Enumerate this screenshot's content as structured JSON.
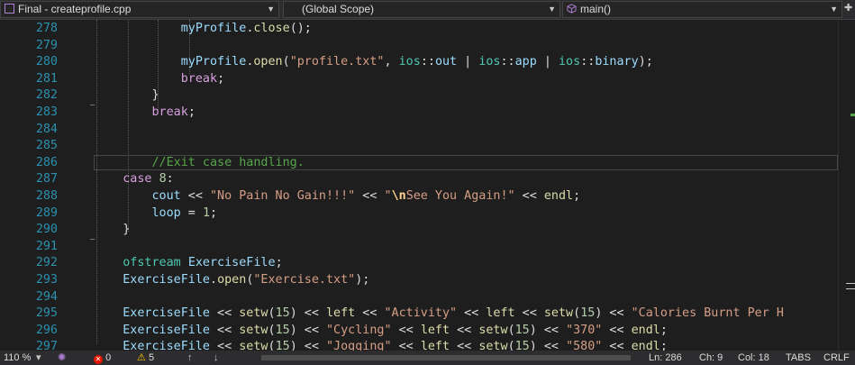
{
  "nav": {
    "file_dropdown": "Final - createprofile.cpp",
    "scope_dropdown": "(Global Scope)",
    "member_dropdown": "main()"
  },
  "code": {
    "lines": [
      {
        "n": "278",
        "html": "            <span class='vr'>myProfile</span>.<span class='fn'>close</span>();"
      },
      {
        "n": "279",
        "html": ""
      },
      {
        "n": "280",
        "html": "            <span class='vr'>myProfile</span>.<span class='fn'>open</span>(<span class='st'>\"profile.txt\"</span>, <span class='ty'>ios</span>::<span class='vr'>out</span> | <span class='ty'>ios</span>::<span class='vr'>app</span> | <span class='ty'>ios</span>::<span class='vr'>binary</span>);"
      },
      {
        "n": "281",
        "html": "            <span class='kw'>break</span>;"
      },
      {
        "n": "282",
        "html": "        }"
      },
      {
        "n": "283",
        "html": "        <span class='kw'>break</span>;"
      },
      {
        "n": "284",
        "html": ""
      },
      {
        "n": "285",
        "html": ""
      },
      {
        "n": "286",
        "html": "        <span class='cm'>//Exit case handling.</span>"
      },
      {
        "n": "287",
        "html": "    <span class='kw'>case</span> <span class='nm'>8</span>:"
      },
      {
        "n": "288",
        "html": "        <span class='vr'>cout</span> &lt;&lt; <span class='st'>\"No Pain No Gain!!!\"</span> &lt;&lt; <span class='st'>\"</span><span class='esc'>\\n</span><span class='st'>See You Again!\"</span> &lt;&lt; <span class='fn'>endl</span>;"
      },
      {
        "n": "289",
        "html": "        <span class='vr'>loop</span> = <span class='nm'>1</span>;"
      },
      {
        "n": "290",
        "html": "    }"
      },
      {
        "n": "291",
        "html": ""
      },
      {
        "n": "292",
        "html": "    <span class='ty'>ofstream</span> <span class='vr'>ExerciseFile</span>;"
      },
      {
        "n": "293",
        "html": "    <span class='vr'>ExerciseFile</span>.<span class='fn'>open</span>(<span class='st'>\"Exercise.txt\"</span>);"
      },
      {
        "n": "294",
        "html": ""
      },
      {
        "n": "295",
        "html": "    <span class='vr'>ExerciseFile</span> &lt;&lt; <span class='fn'>setw</span>(<span class='nm'>15</span>) &lt;&lt; <span class='fn'>left</span> &lt;&lt; <span class='st'>\"Activity\"</span> &lt;&lt; <span class='fn'>left</span> &lt;&lt; <span class='fn'>setw</span>(<span class='nm'>15</span>) &lt;&lt; <span class='st'>\"Calories Burnt Per H</span>"
      },
      {
        "n": "296",
        "html": "    <span class='vr'>ExerciseFile</span> &lt;&lt; <span class='fn'>setw</span>(<span class='nm'>15</span>) &lt;&lt; <span class='st'>\"Cycling\"</span> &lt;&lt; <span class='fn'>left</span> &lt;&lt; <span class='fn'>setw</span>(<span class='nm'>15</span>) &lt;&lt; <span class='st'>\"370\"</span> &lt;&lt; <span class='fn'>endl</span>;"
      },
      {
        "n": "297",
        "html": "    <span class='vr'>ExerciseFile</span> &lt;&lt; <span class='fn'>setw</span>(<span class='nm'>15</span>) &lt;&lt; <span class='st'>\"Jogging\"</span> &lt;&lt; <span class='fn'>left</span> &lt;&lt; <span class='fn'>setw</span>(<span class='nm'>15</span>) &lt;&lt; <span class='st'>\"580\"</span> &lt;&lt; <span class='fn'>endl</span>;"
      }
    ]
  },
  "status": {
    "zoom": "110 %",
    "errors": "0",
    "warnings": "5",
    "ln": "Ln: 286",
    "ch": "Ch: 9",
    "col": "Col: 18",
    "tabs": "TABS",
    "eol": "CRLF"
  },
  "colors": {
    "background": "#1e1e1e",
    "line_number": "#2b91af",
    "keyword": "#d8a0df",
    "string": "#d69d85",
    "comment": "#57a64a"
  }
}
